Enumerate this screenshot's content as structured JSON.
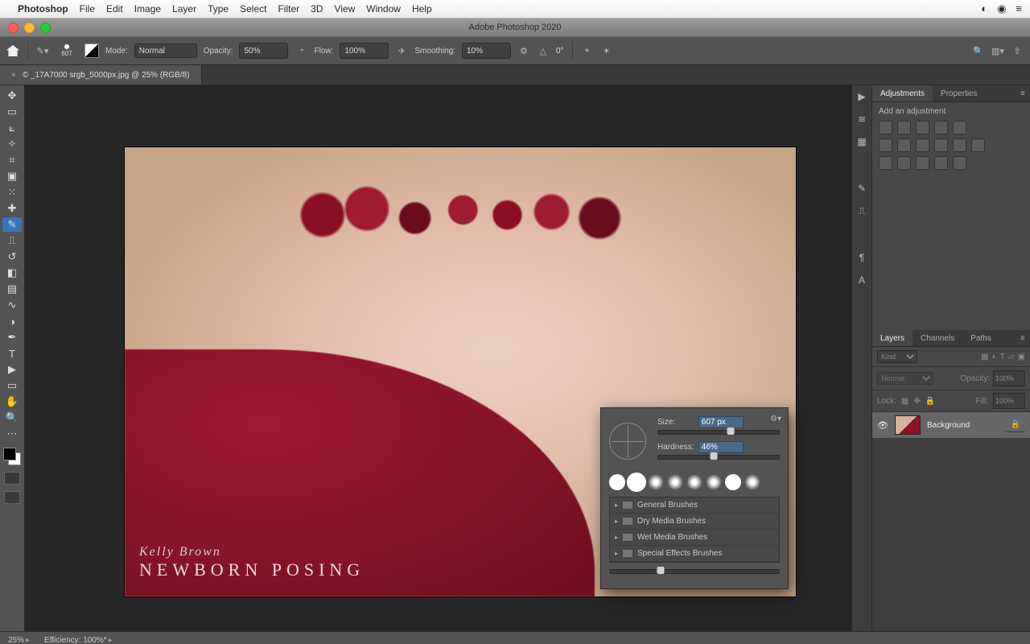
{
  "mac_menu": {
    "app": "Photoshop",
    "items": [
      "File",
      "Edit",
      "Image",
      "Layer",
      "Type",
      "Select",
      "Filter",
      "3D",
      "View",
      "Window",
      "Help"
    ]
  },
  "window_title": "Adobe Photoshop 2020",
  "options_bar": {
    "brush_size_label": "607",
    "mode_label": "Mode:",
    "mode_value": "Normal",
    "opacity_label": "Opacity:",
    "opacity_value": "50%",
    "flow_label": "Flow:",
    "flow_value": "100%",
    "smoothing_label": "Smoothing:",
    "smoothing_value": "10%",
    "angle_label": "0°"
  },
  "document_tab": "© _17A7000 srgb_5000px.jpg @ 25% (RGB/8)",
  "watermark": {
    "line1": "Kelly Brown",
    "line2": "NEWBORN POSING"
  },
  "brush_popover": {
    "size_label": "Size:",
    "size_value": "607 px",
    "hardness_label": "Hardness:",
    "hardness_value": "46%",
    "size_pct": 60,
    "hardness_pct": 46,
    "folders": [
      "General Brushes",
      "Dry Media Brushes",
      "Wet Media Brushes",
      "Special Effects Brushes"
    ]
  },
  "adjustments_panel": {
    "tabs": [
      "Adjustments",
      "Properties"
    ],
    "heading": "Add an adjustment"
  },
  "layers_panel": {
    "tabs": [
      "Layers",
      "Channels",
      "Paths"
    ],
    "kind_placeholder": "Kind",
    "blend_mode": "Normal",
    "opacity_label": "Opacity:",
    "opacity_value": "100%",
    "lock_label": "Lock:",
    "fill_label": "Fill:",
    "fill_value": "100%",
    "layer_name": "Background"
  },
  "status_bar": {
    "zoom": "25%",
    "efficiency": "Efficiency: 100%*"
  }
}
